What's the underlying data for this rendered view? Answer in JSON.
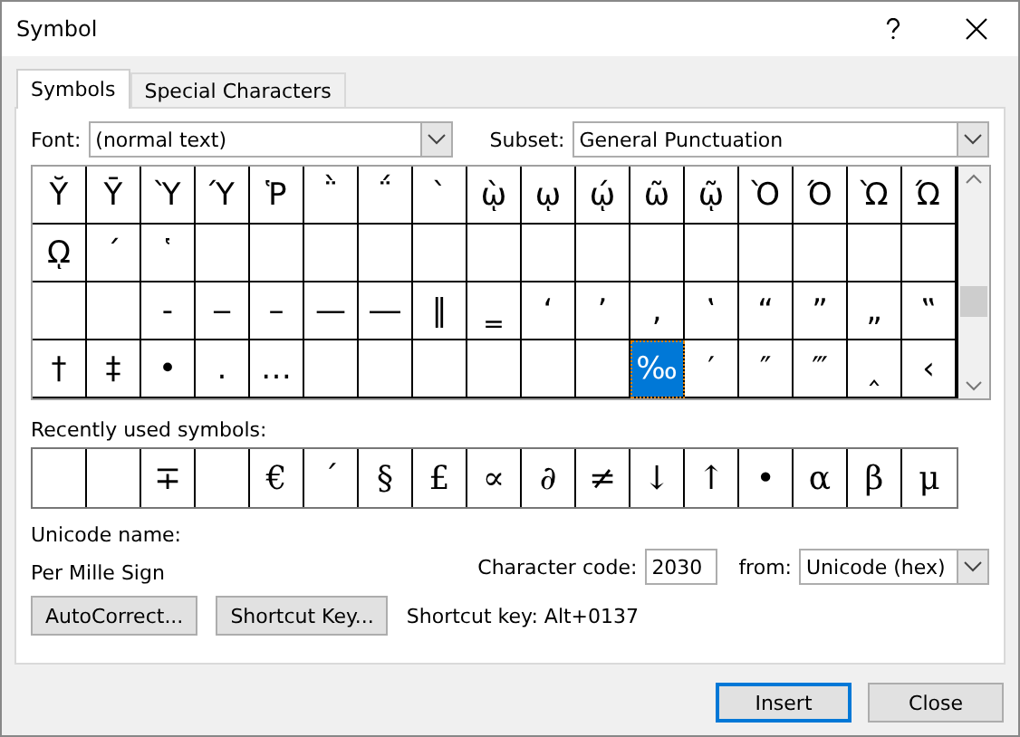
{
  "window": {
    "title": "Symbol"
  },
  "tabs": [
    {
      "label": "Symbols",
      "selected": true
    },
    {
      "label": "Special Characters",
      "selected": false
    }
  ],
  "font": {
    "label": "Font:",
    "value": "(normal text)"
  },
  "subset": {
    "label": "Subset:",
    "value": "General Punctuation"
  },
  "symbol_grid": [
    [
      {
        "symbol": "Ῠ",
        "selected": false
      },
      {
        "symbol": "Ῡ",
        "selected": false
      },
      {
        "symbol": "Ὺ",
        "selected": false
      },
      {
        "symbol": "Ύ",
        "selected": false
      },
      {
        "symbol": "Ῥ",
        "selected": false
      },
      {
        "symbol": "῭",
        "selected": false
      },
      {
        "symbol": "΅",
        "selected": false
      },
      {
        "symbol": "`",
        "selected": false
      },
      {
        "symbol": "ῲ",
        "selected": false
      },
      {
        "symbol": "ῳ",
        "selected": false
      },
      {
        "symbol": "ῴ",
        "selected": false
      },
      {
        "symbol": "ῶ",
        "selected": false
      },
      {
        "symbol": "ῷ",
        "selected": false
      },
      {
        "symbol": "Ὸ",
        "selected": false
      },
      {
        "symbol": "Ό",
        "selected": false
      },
      {
        "symbol": "Ὼ",
        "selected": false
      },
      {
        "symbol": "Ώ",
        "selected": false
      }
    ],
    [
      {
        "symbol": "ῼ",
        "selected": false
      },
      {
        "symbol": "´",
        "selected": false
      },
      {
        "symbol": "῾",
        "selected": false
      },
      {
        "selected": false
      },
      {
        "selected": false
      },
      {
        "selected": false
      },
      {
        "selected": false
      },
      {
        "selected": false
      },
      {
        "selected": false
      },
      {
        "selected": false
      },
      {
        "selected": false
      },
      {
        "selected": false
      },
      {
        "selected": false
      },
      {
        "selected": false
      },
      {
        "selected": false
      },
      {
        "selected": false
      },
      {
        "selected": false
      }
    ],
    [
      {
        "selected": false
      },
      {
        "selected": false
      },
      {
        "symbol": "‐",
        "selected": false
      },
      {
        "symbol": "‒",
        "selected": false
      },
      {
        "symbol": "–",
        "selected": false
      },
      {
        "symbol": "—",
        "selected": false
      },
      {
        "symbol": "―",
        "selected": false
      },
      {
        "symbol": "‖",
        "selected": false
      },
      {
        "symbol": "‗",
        "selected": false
      },
      {
        "symbol": "‘",
        "selected": false
      },
      {
        "symbol": "’",
        "selected": false
      },
      {
        "symbol": "‚",
        "selected": false
      },
      {
        "symbol": "‛",
        "selected": false
      },
      {
        "symbol": "“",
        "selected": false
      },
      {
        "symbol": "”",
        "selected": false
      },
      {
        "symbol": "„",
        "selected": false
      },
      {
        "symbol": "‟",
        "selected": false
      }
    ],
    [
      {
        "symbol": "†",
        "selected": false
      },
      {
        "symbol": "‡",
        "selected": false
      },
      {
        "symbol": "•",
        "selected": false
      },
      {
        "symbol": "․",
        "selected": false
      },
      {
        "symbol": "…",
        "selected": false
      },
      {
        "selected": false
      },
      {
        "selected": false
      },
      {
        "selected": false
      },
      {
        "selected": false
      },
      {
        "selected": false
      },
      {
        "selected": false
      },
      {
        "symbol": "‰",
        "selected": true
      },
      {
        "symbol": "′",
        "selected": false
      },
      {
        "symbol": "″",
        "selected": false
      },
      {
        "symbol": "‴",
        "selected": false
      },
      {
        "symbol": "‸",
        "selected": false
      },
      {
        "symbol": "‹",
        "selected": false
      }
    ]
  ],
  "recent": {
    "label": "Recently used symbols:",
    "symbols": [
      {
        "kind": "blank"
      },
      {
        "kind": "blank"
      },
      {
        "kind": "symbol",
        "symbol": "∓"
      },
      {
        "kind": "blank"
      },
      {
        "kind": "symbol",
        "symbol": "€"
      },
      {
        "kind": "symbol",
        "symbol": "´"
      },
      {
        "kind": "symbol",
        "symbol": "§"
      },
      {
        "kind": "symbol",
        "symbol": "£"
      },
      {
        "kind": "symbol",
        "symbol": "∝"
      },
      {
        "kind": "symbol",
        "symbol": "∂"
      },
      {
        "kind": "symbol",
        "symbol": "≠"
      },
      {
        "kind": "symbol",
        "symbol": "↓"
      },
      {
        "kind": "symbol",
        "symbol": "↑"
      },
      {
        "kind": "symbol",
        "symbol": "•"
      },
      {
        "kind": "symbol",
        "symbol": "α"
      },
      {
        "kind": "symbol",
        "symbol": "β"
      },
      {
        "kind": "symbol",
        "symbol": "μ"
      }
    ]
  },
  "unicode_name": {
    "label": "Unicode name:",
    "value": "Per Mille Sign"
  },
  "character_code": {
    "label": "Character code:",
    "value": "2030"
  },
  "from": {
    "label": "from:",
    "value": "Unicode (hex)"
  },
  "autocorrect_button": "AutoCorrect...",
  "shortcut_key_button": "Shortcut Key...",
  "shortcut_key_text": "Shortcut key: Alt+0137",
  "buttons": [
    {
      "label": "Insert",
      "default": true
    },
    {
      "label": "Close",
      "default": false
    }
  ]
}
